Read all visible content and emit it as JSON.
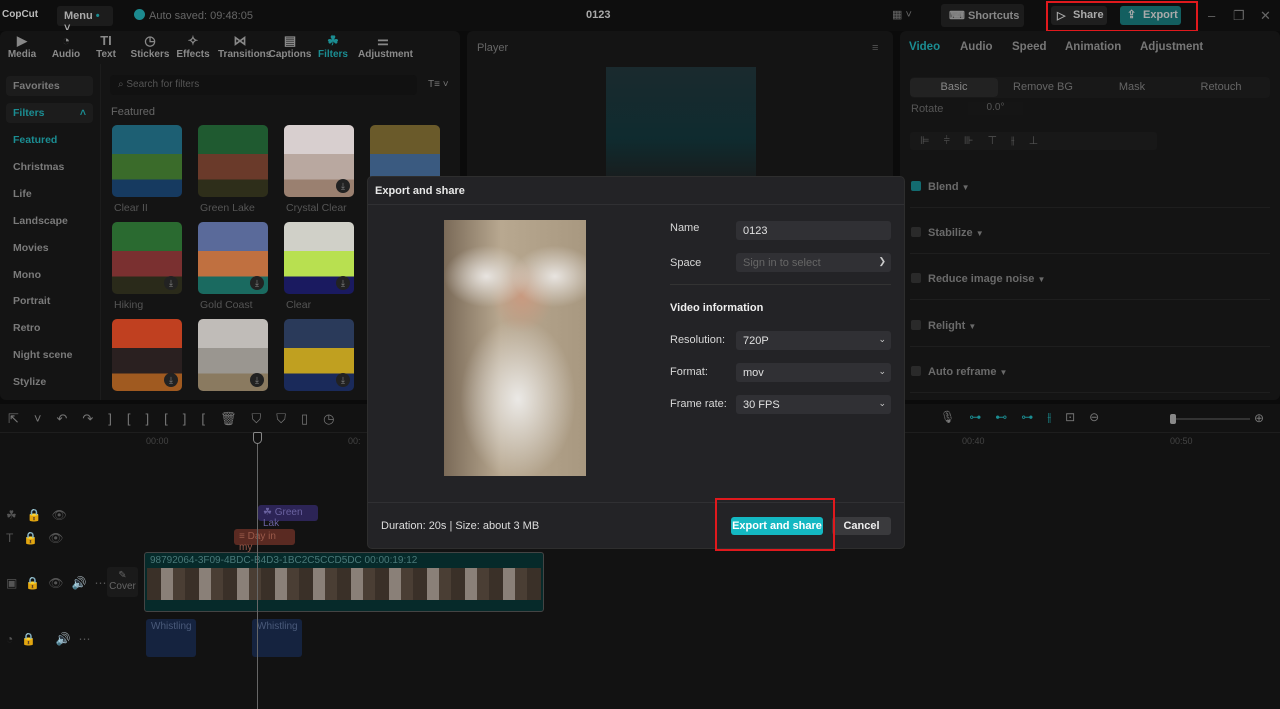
{
  "app": {
    "logo": "CopCut",
    "menu": "Menu",
    "autosaved": "Auto saved: 09:48:05",
    "project_title": "0123",
    "shortcuts": "Shortcuts",
    "share": "Share",
    "export": "Export"
  },
  "toolbar": [
    {
      "label": "Media",
      "icon": "▶"
    },
    {
      "label": "Audio",
      "icon": "◔"
    },
    {
      "label": "Text",
      "icon": "TI"
    },
    {
      "label": "Stickers",
      "icon": "◷"
    },
    {
      "label": "Effects",
      "icon": "✧"
    },
    {
      "label": "Transitions",
      "icon": "⋈"
    },
    {
      "label": "Captions",
      "icon": "▤"
    },
    {
      "label": "Filters",
      "icon": "☘"
    },
    {
      "label": "Adjustment",
      "icon": "⚌"
    }
  ],
  "sidebar": {
    "favorites": "Favorites",
    "filters": "Filters",
    "categories": [
      "Featured",
      "Christmas",
      "Life",
      "Landscape",
      "Movies",
      "Mono",
      "Portrait",
      "Retro",
      "Night scene",
      "Stylize"
    ]
  },
  "filters": {
    "search_placeholder": "Search for filters",
    "section": "Featured",
    "items": [
      {
        "label": "Clear II",
        "colors": [
          "#1d5f73",
          "#3a6b2a",
          "#163a60"
        ]
      },
      {
        "label": "Green Lake",
        "colors": [
          "#1f5a30",
          "#6a3a2a",
          "#2e2e1a"
        ]
      },
      {
        "label": "Crystal Clear",
        "colors": [
          "#d8cfcf",
          "#b9a8a0",
          "#9a8070"
        ]
      },
      {
        "label": "",
        "colors": [
          "#6a5a2a",
          "#3a5a80",
          "#3a3a30"
        ]
      },
      {
        "label": "Hiking",
        "colors": [
          "#2a6a30",
          "#7a3030",
          "#2a2a1a"
        ]
      },
      {
        "label": "Gold Coast",
        "colors": [
          "#5a6a9a",
          "#c07040",
          "#1a6a60"
        ]
      },
      {
        "label": "Clear",
        "colors": [
          "#d0d0c8",
          "#b8e050",
          "#1a1a60"
        ]
      },
      {
        "label": "",
        "colors": [
          "#c04020",
          "#2a2020",
          "#a05a20"
        ]
      },
      {
        "label": "",
        "colors": [
          "#c0bcb8",
          "#9a9690",
          "#8a7a60"
        ]
      },
      {
        "label": "",
        "colors": [
          "#2a3a5a",
          "#c0a020",
          "#1a2a5a"
        ]
      }
    ]
  },
  "player": {
    "title": "Player"
  },
  "right_panel": {
    "tabs": [
      "Video",
      "Audio",
      "Speed",
      "Animation",
      "Adjustment"
    ],
    "subtabs": [
      "Basic",
      "Remove BG",
      "Mask",
      "Retouch"
    ],
    "rotate_label": "Rotate",
    "rotate_value": "0.0°",
    "properties": [
      {
        "label": "Blend",
        "checked": true
      },
      {
        "label": "Stabilize",
        "checked": false
      },
      {
        "label": "Reduce image noise",
        "checked": false
      },
      {
        "label": "Relight",
        "checked": false
      },
      {
        "label": "Auto reframe",
        "checked": false
      }
    ]
  },
  "timeline": {
    "ruler": [
      "00:00",
      "00:",
      "00:40",
      "00:50"
    ],
    "filter_clip": "Green Lak",
    "text_clip": "Day in my",
    "video_clip": "98792064-3F09-4BDC-B4D3-1BC2C5CCD5DC  00:00:19:12",
    "cover": "Cover",
    "audio_clips": [
      "Whistling",
      "Whistling"
    ]
  },
  "modal": {
    "title": "Export and share",
    "name_label": "Name",
    "name_value": "0123",
    "space_label": "Space",
    "space_placeholder": "Sign in to select",
    "section": "Video information",
    "resolution_label": "Resolution:",
    "resolution_value": "720P",
    "format_label": "Format:",
    "format_value": "mov",
    "framerate_label": "Frame rate:",
    "framerate_value": "30 FPS",
    "summary": "Duration: 20s | Size: about 3 MB",
    "export_button": "Export and share",
    "cancel_button": "Cancel"
  },
  "colors": {
    "accent": "#14b8c2",
    "highlight_box": "#e0191d"
  }
}
